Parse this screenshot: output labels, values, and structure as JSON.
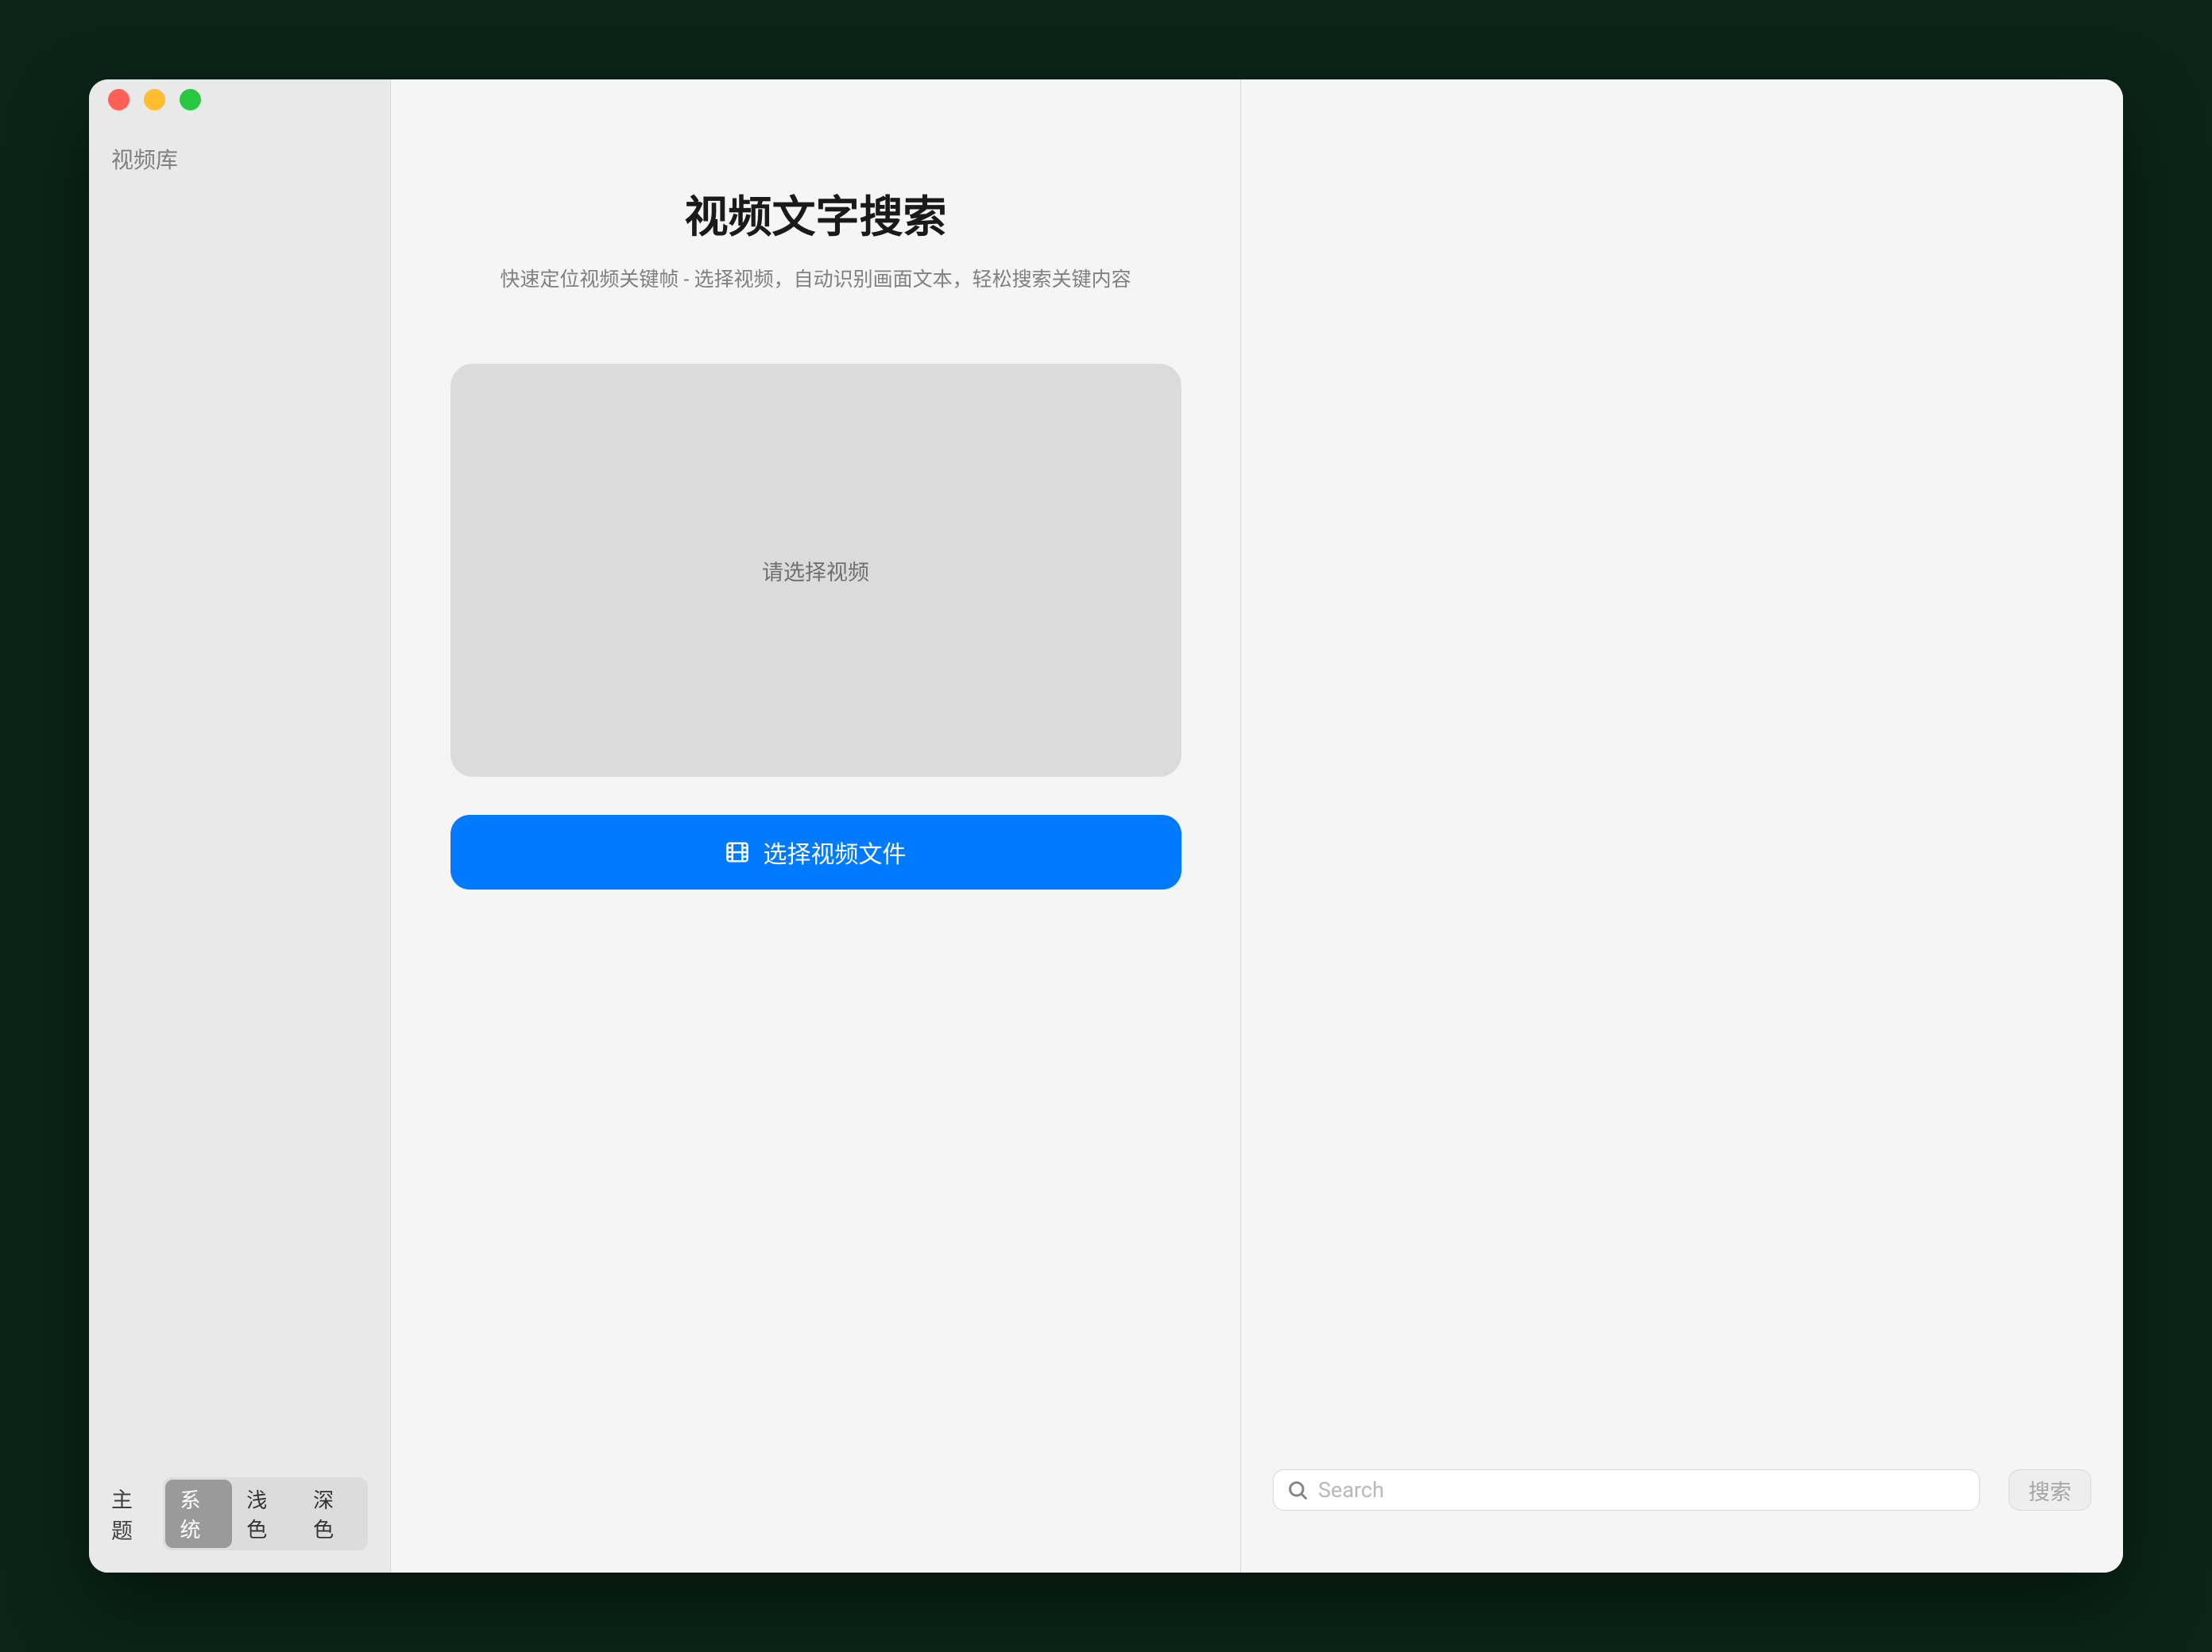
{
  "sidebar": {
    "title": "视频库",
    "theme_label": "主题",
    "theme_options": {
      "system": "系统",
      "light": "浅色",
      "dark": "深色"
    }
  },
  "center": {
    "title": "视频文字搜索",
    "subtitle": "快速定位视频关键帧 - 选择视频，自动识别画面文本，轻松搜索关键内容",
    "video_placeholder": "请选择视频",
    "select_button": "选择视频文件"
  },
  "right": {
    "search_placeholder": "Search",
    "search_button": "搜索"
  }
}
